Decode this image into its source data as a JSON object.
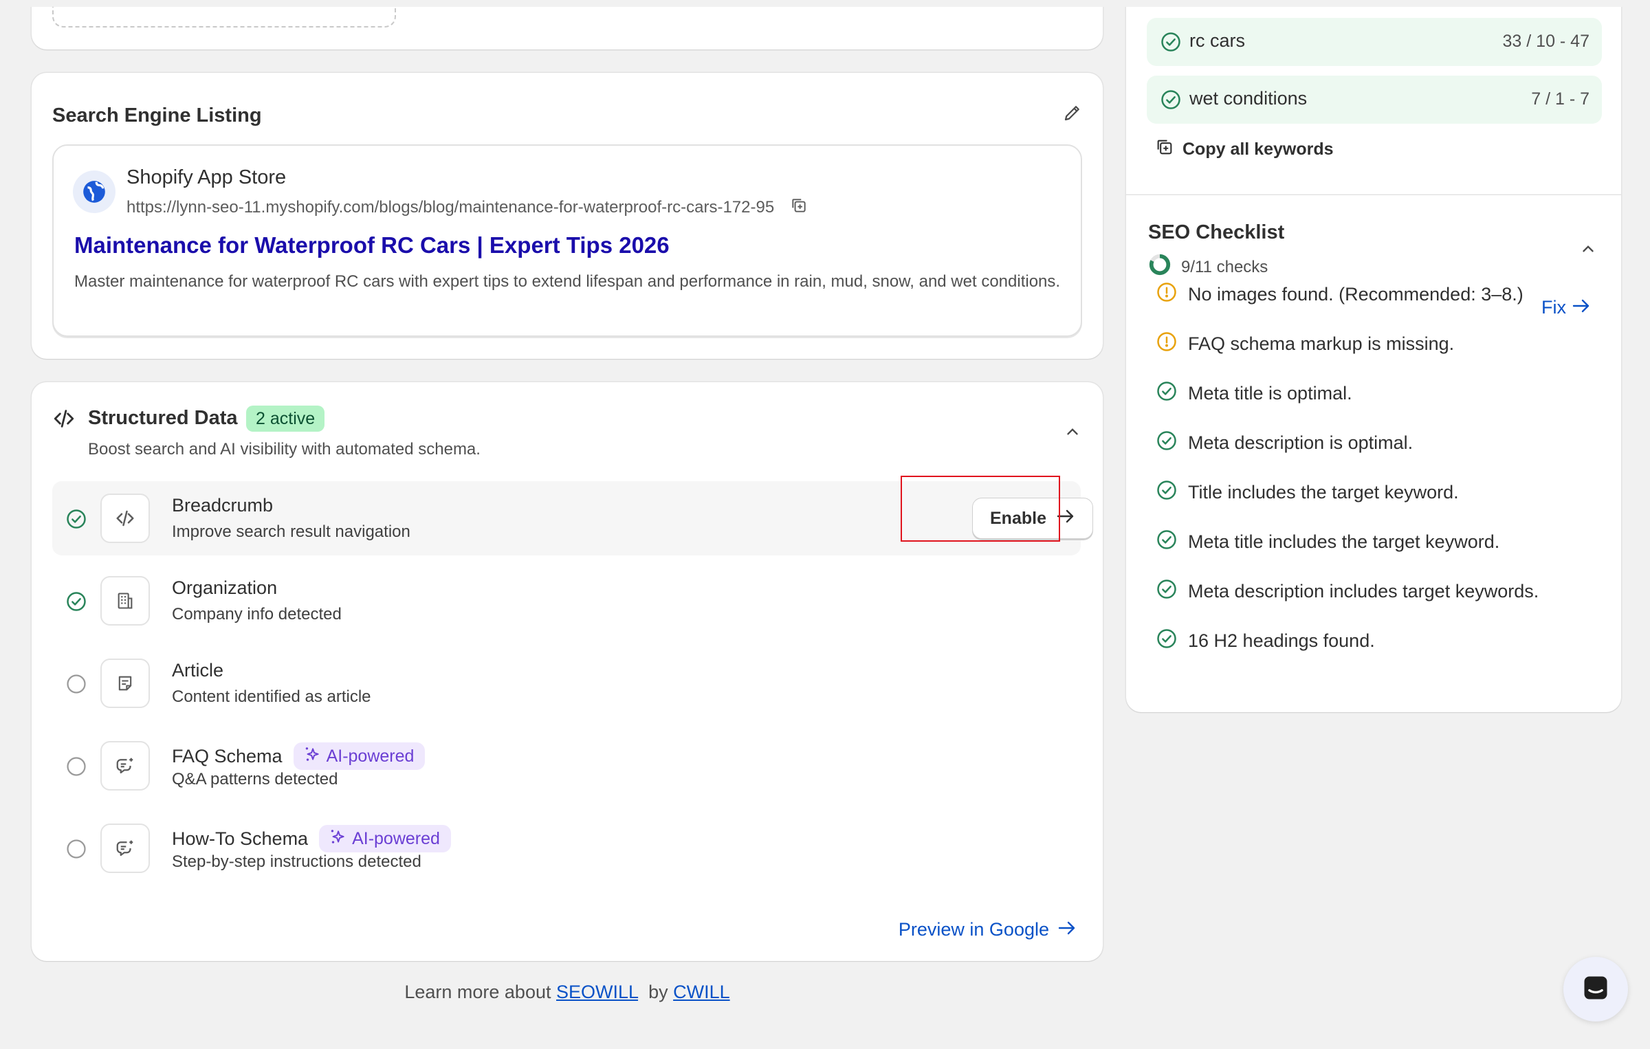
{
  "search_listing": {
    "title": "Search Engine Listing",
    "site_name": "Shopify App Store",
    "url": "https://lynn-seo-11.myshopify.com/blogs/blog/maintenance-for-waterproof-rc-cars-172-95",
    "page_title": "Maintenance for Waterproof RC Cars | Expert Tips 2026",
    "description": "Master maintenance for waterproof RC cars with expert tips to extend lifespan and performance in rain, mud, snow, and wet conditions."
  },
  "structured_data": {
    "title": "Structured Data",
    "badge": "2 active",
    "subtitle": "Boost search and AI visibility with automated schema.",
    "items": [
      {
        "title": "Breadcrumb",
        "desc": "Improve search result navigation",
        "status": "enabled",
        "icon": "code-icon",
        "action": "Enable"
      },
      {
        "title": "Organization",
        "desc": "Company info detected",
        "status": "enabled",
        "icon": "building-icon"
      },
      {
        "title": "Article",
        "desc": "Content identified as article",
        "status": "off",
        "icon": "article-icon"
      },
      {
        "title": "FAQ Schema",
        "desc": "Q&A patterns detected",
        "status": "off",
        "icon": "chat-icon",
        "badge": "AI-powered"
      },
      {
        "title": "How-To Schema",
        "desc": "Step-by-step instructions detected",
        "status": "off",
        "icon": "chat-icon",
        "badge": "AI-powered"
      }
    ],
    "preview_link": "Preview in Google"
  },
  "footer": {
    "prefix": "Learn more about",
    "brand": "SEOWILL",
    "by": "by",
    "company": "CWILL"
  },
  "keywords": {
    "items": [
      {
        "name": "rc cars",
        "value": "33 / 10 - 47"
      },
      {
        "name": "wet conditions",
        "value": "7 / 1 - 7"
      }
    ],
    "copy_label": "Copy all keywords"
  },
  "seo_checklist": {
    "title": "SEO Checklist",
    "count": "9/11 checks",
    "progress": 0.818,
    "fix_label": "Fix",
    "items": [
      {
        "text": "No images found. (Recommended: 3–8.)",
        "status": "warning"
      },
      {
        "text": "FAQ schema markup is missing.",
        "status": "warning"
      },
      {
        "text": "Meta title is optimal.",
        "status": "pass"
      },
      {
        "text": "Meta description is optimal.",
        "status": "pass"
      },
      {
        "text": "Title includes the target keyword.",
        "status": "pass"
      },
      {
        "text": "Meta title includes the target keyword.",
        "status": "pass"
      },
      {
        "text": "Meta description includes target keywords.",
        "status": "pass"
      },
      {
        "text": "16 H2 headings found.",
        "status": "pass"
      }
    ]
  },
  "colors": {
    "success": "#29845a",
    "warning": "#e8a20c",
    "link": "#0a52c7",
    "serp_title": "#1a0dab",
    "ai": "#6b3fd4"
  }
}
